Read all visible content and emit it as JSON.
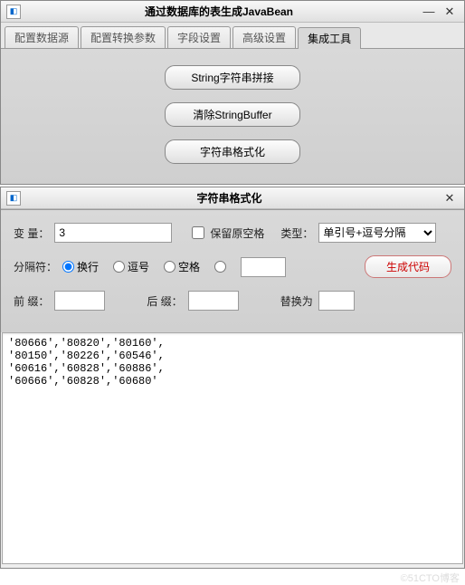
{
  "win1": {
    "title": "通过数据库的表生成JavaBean",
    "tabs": [
      "配置数据源",
      "配置转换参数",
      "字段设置",
      "高级设置",
      "集成工具"
    ],
    "active_tab": 4,
    "buttons": {
      "concat": "String字符串拼接",
      "clear": "清除StringBuffer",
      "format": "字符串格式化"
    }
  },
  "win2": {
    "title": "字符串格式化",
    "labels": {
      "var": "变 量：",
      "keepspace": "保留原空格",
      "type": "类型：",
      "sep": "分隔符：",
      "newline": "换行",
      "comma": "逗号",
      "space": "空格",
      "gen": "生成代码",
      "prefix": "前 缀：",
      "suffix": "后 缀：",
      "replace": "替换为"
    },
    "values": {
      "var": "3",
      "type_selected": "单引号+逗号分隔",
      "prefix": "",
      "suffix": "",
      "replace": "",
      "custom_sep": ""
    },
    "output": "'80666','80820','80160',\n'80150','80226','60546',\n'60616','60828','60886',\n'60666','60828','60680'"
  },
  "watermark": "©51CTO博客"
}
